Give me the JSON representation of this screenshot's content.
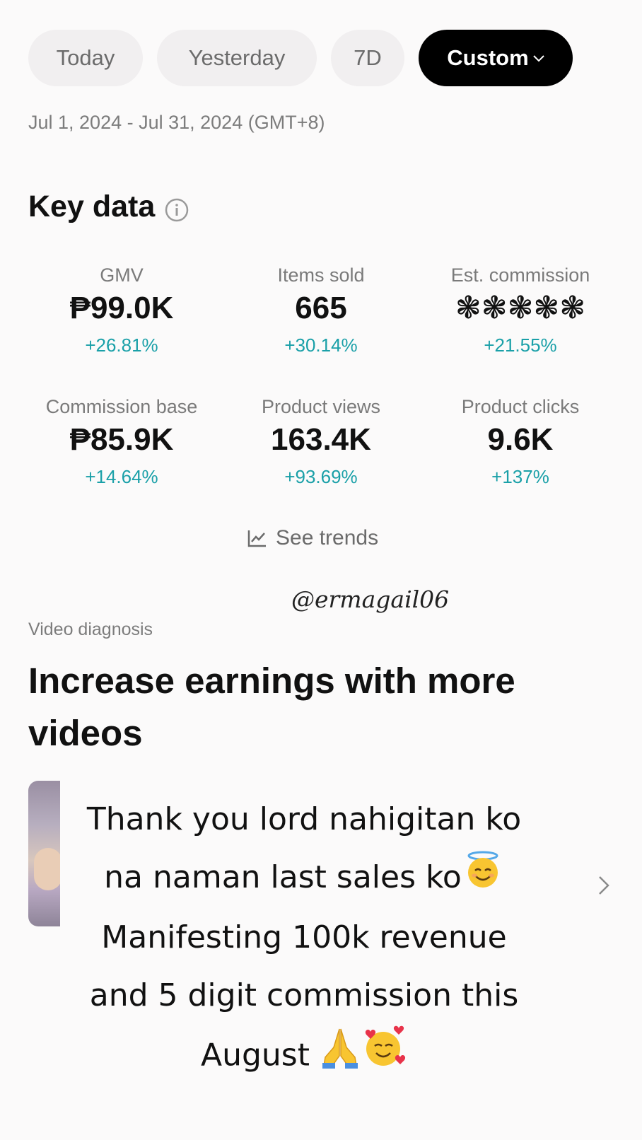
{
  "date_tabs": {
    "today": "Today",
    "yesterday": "Yesterday",
    "seven_days": "7D",
    "custom": "Custom",
    "custom_chevron": "⌄"
  },
  "date_range": "Jul 1, 2024 - Jul 31, 2024 (GMT+8)",
  "key_data": {
    "title": "Key data",
    "info_icon": "info-icon",
    "metrics": [
      {
        "label": "GMV",
        "value": "₱99.0K",
        "delta": "+26.81%"
      },
      {
        "label": "Items sold",
        "value": "665",
        "delta": "+30.14%"
      },
      {
        "label": "Est. commission",
        "value": "❃❃❃❃❃",
        "delta": "+21.55%"
      },
      {
        "label": "Commission base",
        "value": "₱85.9K",
        "delta": "+14.64%"
      },
      {
        "label": "Product views",
        "value": "163.4K",
        "delta": "+93.69%"
      },
      {
        "label": "Product clicks",
        "value": "9.6K",
        "delta": "+137%"
      }
    ],
    "see_trends": "See trends"
  },
  "watermark": "@ermagail06",
  "video_diagnosis": {
    "label": "Video diagnosis",
    "headline": "Increase earnings with more videos"
  },
  "caption": {
    "line1": "Thank you lord nahigitan ko",
    "line2": "na naman last sales ko",
    "line3": "Manifesting 100k revenue",
    "line4": "and 5 digit commission this",
    "line5": "August"
  },
  "colors": {
    "accent_delta": "#1aa0a8",
    "custom_tab_bg": "#000000"
  }
}
